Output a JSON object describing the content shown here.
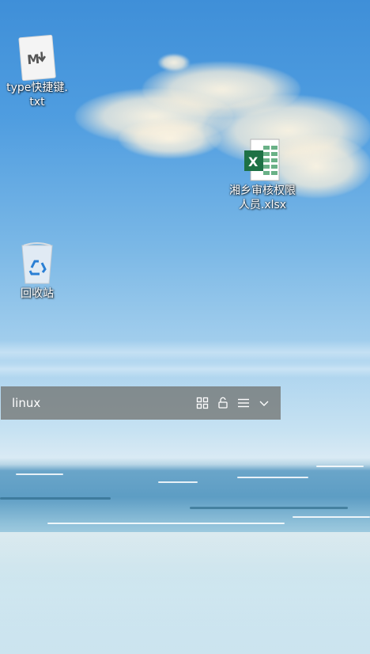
{
  "desktop": {
    "icons": [
      {
        "label": "type快捷键.\ntxt",
        "icon": "markdown-file-icon"
      },
      {
        "label": "湘乡审核权限\n人员.xlsx",
        "icon": "excel-file-icon"
      },
      {
        "label": "回收站",
        "icon": "recycle-bin-icon"
      }
    ]
  },
  "toolbar": {
    "title": "linux",
    "buttons": [
      {
        "icon": "grid-icon"
      },
      {
        "icon": "unlock-icon"
      },
      {
        "icon": "menu-icon"
      },
      {
        "icon": "chevron-down-icon"
      }
    ]
  },
  "colors": {
    "sky_top": "#3f8fd8",
    "toolbar_bg": "rgba(110,110,105,0.72)",
    "excel_green": "#1e7145",
    "recycle_blue": "#2a7fd4"
  }
}
